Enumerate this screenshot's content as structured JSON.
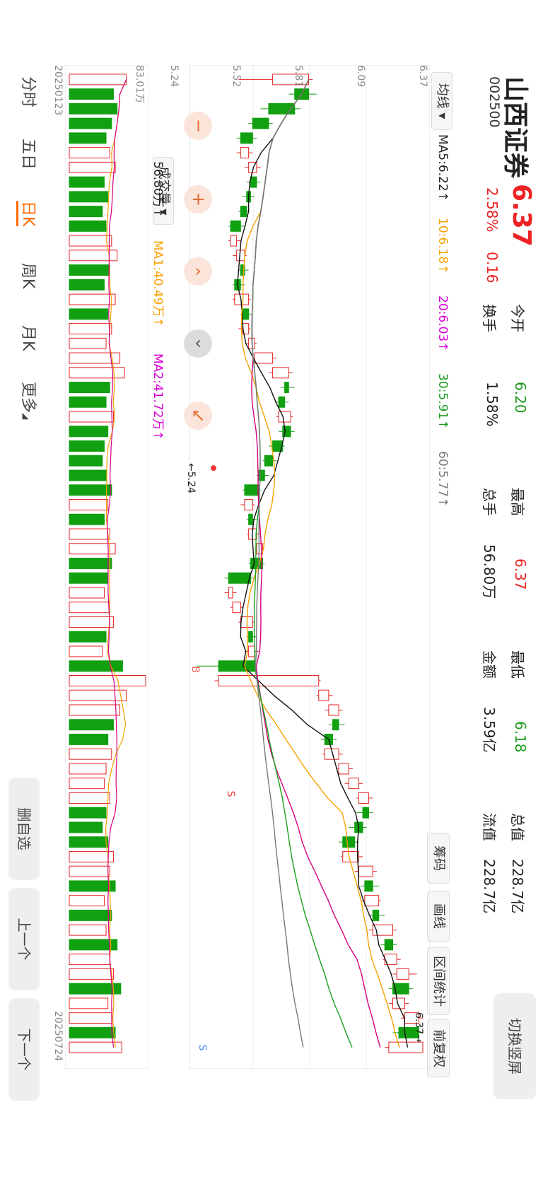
{
  "stock": {
    "name": "山西证券",
    "code": "002500",
    "price": "6.37",
    "change_pct": "2.58%",
    "change": "0.16"
  },
  "stats": {
    "open_label": "今开",
    "open": "6.20",
    "turnover_label": "换手",
    "turnover": "1.58%",
    "high_label": "最高",
    "high": "6.37",
    "volume_label": "总手",
    "volume": "56.80万",
    "low_label": "最低",
    "low": "6.18",
    "amount_label": "金额",
    "amount": "3.59亿",
    "total_cap_label": "总值",
    "total_cap": "228.7亿",
    "float_cap_label": "流值",
    "float_cap": "228.7亿"
  },
  "buttons": {
    "switch_portrait": "切换竖屏",
    "chips": "筹码",
    "draw_line": "画线",
    "interval_stats": "区间统计",
    "fq": "前复权",
    "remove_watch": "删自选",
    "prev": "上一个",
    "next": "下一个"
  },
  "indicator": {
    "ma_selector": "均线",
    "ma5": "MA5:6.22↑",
    "ma10": "10:6.18↑",
    "ma20": "20:6.03↑",
    "ma30": "30:5.91↑",
    "ma60": "60:5.77↑",
    "vol_selector": "成交量",
    "vol_value": "56.80万↑",
    "vol_ma1": "MA1:40.49万↑",
    "vol_ma2": "MA2:41.72万↑"
  },
  "axes": {
    "price_ticks": [
      "6.37",
      "6.09",
      "5.81",
      "5.52",
      "5.24"
    ],
    "vol_top": "83.01万",
    "vol_bottom": "0",
    "date_start": "20250123",
    "date_end": "20250724",
    "max_marker": "6.37→",
    "min_marker": "←5.24",
    "b_marker": "B",
    "s_marker": "S",
    "s_marker_mid": "S"
  },
  "controls": {
    "zoom_out": "−",
    "zoom_in": "+",
    "left": "‹",
    "right": "‹",
    "reset": "↙"
  },
  "periods": [
    "分时",
    "五日",
    "日K",
    "周K",
    "月K",
    "更多"
  ],
  "active_period": "日K",
  "colors": {
    "up": "#e62222",
    "down": "#10a010",
    "ma5": "#111111",
    "ma10": "#f5a100",
    "ma20": "#d6007f",
    "ma30": "#19a019",
    "ma60": "#777777",
    "accent": "#ff6a00"
  },
  "chart_data": {
    "type": "candlestick",
    "title": "",
    "y_range": [
      5.24,
      6.37
    ],
    "candles": [
      {
        "o": 5.62,
        "c": 5.8,
        "h": 5.82,
        "l": 5.45
      },
      {
        "o": 5.8,
        "c": 5.73,
        "h": 5.84,
        "l": 5.7
      },
      {
        "o": 5.73,
        "c": 5.6,
        "h": 5.76,
        "l": 5.56
      },
      {
        "o": 5.6,
        "c": 5.52,
        "h": 5.62,
        "l": 5.5
      },
      {
        "o": 5.52,
        "c": 5.46,
        "h": 5.54,
        "l": 5.44
      },
      {
        "o": 5.46,
        "c": 5.5,
        "h": 5.52,
        "l": 5.44
      },
      {
        "o": 5.5,
        "c": 5.54,
        "h": 5.56,
        "l": 5.48
      },
      {
        "o": 5.54,
        "c": 5.51,
        "h": 5.56,
        "l": 5.49
      },
      {
        "o": 5.51,
        "c": 5.49,
        "h": 5.53,
        "l": 5.47
      },
      {
        "o": 5.49,
        "c": 5.46,
        "h": 5.5,
        "l": 5.45
      },
      {
        "o": 5.46,
        "c": 5.41,
        "h": 5.48,
        "l": 5.4
      },
      {
        "o": 5.41,
        "c": 5.44,
        "h": 5.46,
        "l": 5.4
      },
      {
        "o": 5.44,
        "c": 5.48,
        "h": 5.49,
        "l": 5.42
      },
      {
        "o": 5.48,
        "c": 5.46,
        "h": 5.5,
        "l": 5.45
      },
      {
        "o": 5.46,
        "c": 5.43,
        "h": 5.48,
        "l": 5.42
      },
      {
        "o": 5.43,
        "c": 5.5,
        "h": 5.51,
        "l": 5.42
      },
      {
        "o": 5.5,
        "c": 5.47,
        "h": 5.52,
        "l": 5.46
      },
      {
        "o": 5.47,
        "c": 5.5,
        "h": 5.51,
        "l": 5.45
      },
      {
        "o": 5.5,
        "c": 5.53,
        "h": 5.54,
        "l": 5.49
      },
      {
        "o": 5.53,
        "c": 5.62,
        "h": 5.64,
        "l": 5.52
      },
      {
        "o": 5.62,
        "c": 5.7,
        "h": 5.72,
        "l": 5.6
      },
      {
        "o": 5.7,
        "c": 5.68,
        "h": 5.73,
        "l": 5.66
      },
      {
        "o": 5.68,
        "c": 5.65,
        "h": 5.7,
        "l": 5.63
      },
      {
        "o": 5.65,
        "c": 5.71,
        "h": 5.72,
        "l": 5.64
      },
      {
        "o": 5.71,
        "c": 5.67,
        "h": 5.73,
        "l": 5.65
      },
      {
        "o": 5.67,
        "c": 5.62,
        "h": 5.68,
        "l": 5.6
      },
      {
        "o": 5.62,
        "c": 5.58,
        "h": 5.64,
        "l": 5.57
      },
      {
        "o": 5.58,
        "c": 5.55,
        "h": 5.6,
        "l": 5.54
      },
      {
        "o": 5.55,
        "c": 5.48,
        "h": 5.56,
        "l": 5.47
      },
      {
        "o": 5.48,
        "c": 5.52,
        "h": 5.53,
        "l": 5.46
      },
      {
        "o": 5.52,
        "c": 5.5,
        "h": 5.54,
        "l": 5.49
      },
      {
        "o": 5.5,
        "c": 5.54,
        "h": 5.56,
        "l": 5.49
      },
      {
        "o": 5.54,
        "c": 5.57,
        "h": 5.58,
        "l": 5.53
      },
      {
        "o": 5.57,
        "c": 5.51,
        "h": 5.58,
        "l": 5.5
      },
      {
        "o": 5.51,
        "c": 5.4,
        "h": 5.53,
        "l": 5.38
      },
      {
        "o": 5.4,
        "c": 5.42,
        "h": 5.44,
        "l": 5.38
      },
      {
        "o": 5.42,
        "c": 5.46,
        "h": 5.47,
        "l": 5.41
      },
      {
        "o": 5.46,
        "c": 5.52,
        "h": 5.53,
        "l": 5.45
      },
      {
        "o": 5.52,
        "c": 5.5,
        "h": 5.54,
        "l": 5.49
      },
      {
        "o": 5.5,
        "c": 5.53,
        "h": 5.55,
        "l": 5.48
      },
      {
        "o": 5.53,
        "c": 5.35,
        "h": 5.54,
        "l": 5.24
      },
      {
        "o": 5.35,
        "c": 5.85,
        "h": 5.86,
        "l": 5.33
      },
      {
        "o": 5.85,
        "c": 5.9,
        "h": 5.92,
        "l": 5.84
      },
      {
        "o": 5.9,
        "c": 5.95,
        "h": 5.97,
        "l": 5.88
      },
      {
        "o": 5.95,
        "c": 5.92,
        "h": 5.98,
        "l": 5.9
      },
      {
        "o": 5.92,
        "c": 5.88,
        "h": 5.94,
        "l": 5.86
      },
      {
        "o": 5.88,
        "c": 5.95,
        "h": 5.97,
        "l": 5.87
      },
      {
        "o": 5.95,
        "c": 6.0,
        "h": 6.02,
        "l": 5.94
      },
      {
        "o": 6.0,
        "c": 6.05,
        "h": 6.07,
        "l": 5.98
      },
      {
        "o": 6.05,
        "c": 6.1,
        "h": 6.12,
        "l": 6.04
      },
      {
        "o": 6.1,
        "c": 6.07,
        "h": 6.12,
        "l": 6.04
      },
      {
        "o": 6.07,
        "c": 6.03,
        "h": 6.09,
        "l": 6.0
      },
      {
        "o": 6.03,
        "c": 5.97,
        "h": 6.05,
        "l": 5.95
      },
      {
        "o": 5.97,
        "c": 6.05,
        "h": 6.07,
        "l": 5.96
      },
      {
        "o": 6.05,
        "c": 6.12,
        "h": 6.14,
        "l": 6.03
      },
      {
        "o": 6.12,
        "c": 6.08,
        "h": 6.15,
        "l": 6.06
      },
      {
        "o": 6.08,
        "c": 6.15,
        "h": 6.16,
        "l": 6.06
      },
      {
        "o": 6.15,
        "c": 6.12,
        "h": 6.18,
        "l": 6.1
      },
      {
        "o": 6.12,
        "c": 6.22,
        "h": 6.24,
        "l": 6.1
      },
      {
        "o": 6.22,
        "c": 6.18,
        "h": 6.24,
        "l": 6.16
      },
      {
        "o": 6.18,
        "c": 6.24,
        "h": 6.26,
        "l": 6.17
      },
      {
        "o": 6.24,
        "c": 6.3,
        "h": 6.34,
        "l": 6.22
      },
      {
        "o": 6.3,
        "c": 6.22,
        "h": 6.32,
        "l": 6.2
      },
      {
        "o": 6.22,
        "c": 6.28,
        "h": 6.3,
        "l": 6.2
      },
      {
        "o": 6.28,
        "c": 6.35,
        "h": 6.37,
        "l": 6.26
      },
      {
        "o": 6.35,
        "c": 6.25,
        "h": 6.36,
        "l": 6.22
      },
      {
        "o": 6.2,
        "c": 6.37,
        "h": 6.37,
        "l": 6.18
      }
    ],
    "volume": [
      62,
      48,
      52,
      46,
      40,
      44,
      50,
      38,
      42,
      36,
      40,
      46,
      52,
      44,
      38,
      50,
      42,
      46,
      40,
      55,
      60,
      44,
      40,
      48,
      42,
      38,
      36,
      40,
      46,
      42,
      38,
      44,
      50,
      46,
      42,
      38,
      44,
      48,
      40,
      36,
      58,
      83,
      62,
      55,
      48,
      42,
      46,
      40,
      38,
      44,
      40,
      36,
      42,
      48,
      44,
      50,
      38,
      46,
      40,
      52,
      44,
      48,
      56,
      42,
      46,
      50,
      57
    ],
    "volume_axis": [
      0,
      83.01
    ]
  }
}
